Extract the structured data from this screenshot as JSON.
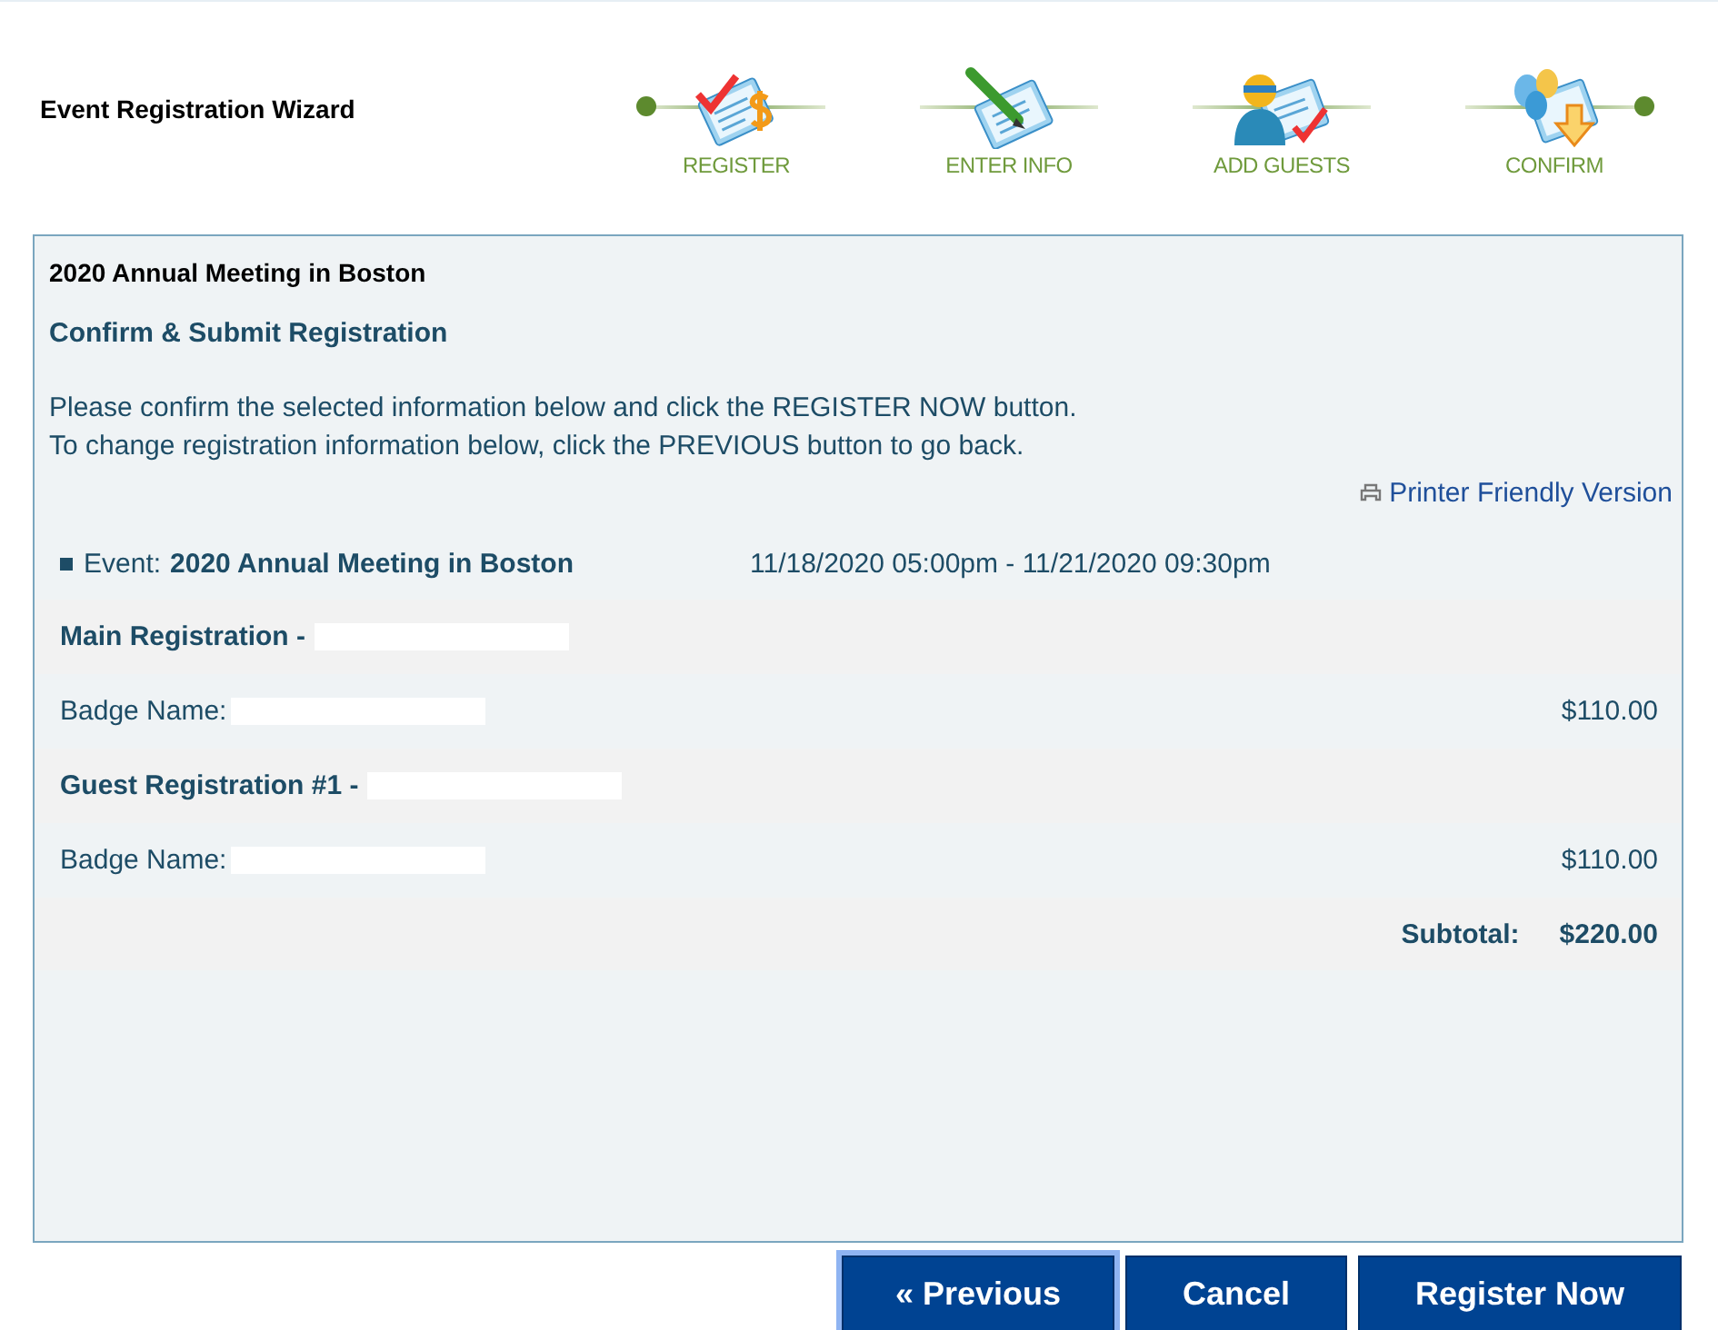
{
  "wizard": {
    "title": "Event Registration Wizard",
    "steps": [
      {
        "label": "REGISTER",
        "kind": "register"
      },
      {
        "label": "ENTER INFO",
        "kind": "info"
      },
      {
        "label": "ADD GUESTS",
        "kind": "guests"
      },
      {
        "label": "CONFIRM",
        "kind": "confirm"
      }
    ]
  },
  "panel": {
    "event_title": "2020 Annual Meeting in Boston",
    "heading": "Confirm & Submit Registration",
    "instructions": [
      "Please confirm the selected information below and click the REGISTER NOW button.",
      "To change registration information below, click the PREVIOUS button to go back."
    ],
    "printer_link": "Printer Friendly Version",
    "event": {
      "label": "Event:",
      "name": "2020 Annual Meeting in Boston",
      "dates": "11/18/2020 05:00pm - 11/21/2020 09:30pm"
    },
    "rows": [
      {
        "kind": "header",
        "label": "Main Registration -"
      },
      {
        "kind": "item",
        "label": "Badge Name:",
        "amount": "$110.00"
      },
      {
        "kind": "header",
        "label": "Guest Registration #1 -"
      },
      {
        "kind": "item",
        "label": "Badge Name:",
        "amount": "$110.00"
      }
    ],
    "subtotal": {
      "label": "Subtotal:",
      "amount": "$220.00"
    }
  },
  "buttons": [
    {
      "label": "« Previous",
      "focused": true
    },
    {
      "label": "Cancel",
      "focused": false
    },
    {
      "label": "Register Now",
      "focused": false
    }
  ]
}
